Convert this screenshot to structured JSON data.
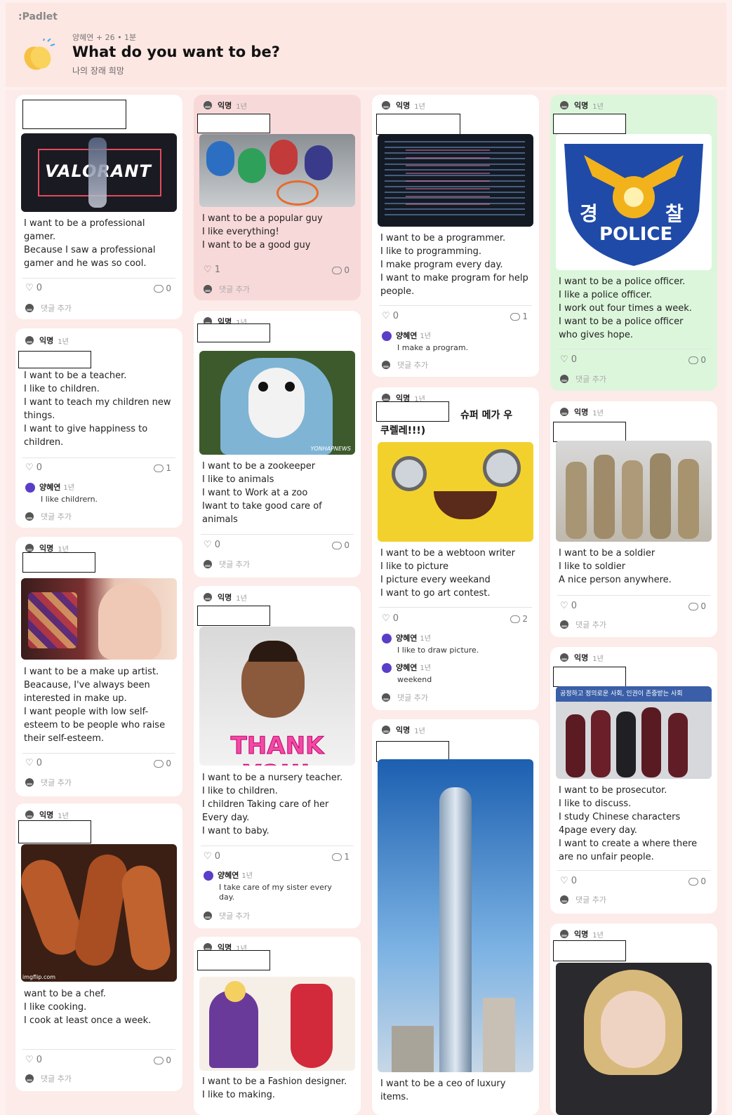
{
  "app": {
    "logo": ":Padlet"
  },
  "header": {
    "meta": "양혜연 + 26 • 1분",
    "title": "What do you want to be?",
    "subtitle": "나의 장래 희망"
  },
  "common": {
    "anon": "익명",
    "time": "1년",
    "add_comment": "댓글 추가",
    "commenter": "양혜연"
  },
  "posts": {
    "valorant": {
      "body": "I want to be a professional\ngamer.\nBecause I saw a professional\ngamer and he was so cool.",
      "likes": "0",
      "comments": "0"
    },
    "teacher": {
      "body": "I want to be a teacher.\nI like to children.\nI want to teach my children new\nthings.\nI want to give happiness to\nchildren.",
      "likes": "0",
      "comments": "1",
      "reply": "I like childrern."
    },
    "makeup": {
      "body": "I want to be a make up artist.\nBeacause, I've always been\ninterested in make up.\nI want people with low self-\nesteem to be people who raise\ntheir self-esteem.",
      "likes": "0",
      "comments": "0"
    },
    "chef": {
      "body": "want to be a chef.\nI like cooking.\nI cook at least once a week.",
      "likes": "0",
      "comments": "0"
    },
    "popular": {
      "body": "I want to be a popular guy\nI like everything!\nI want to be a good guy",
      "likes": "1",
      "comments": "0"
    },
    "zookeeper": {
      "body": "I want to be a zookeeper\nI like to animals\nI want to Work at a zoo\nIwant to take good care of\nanimals",
      "likes": "0",
      "comments": "0"
    },
    "nursery": {
      "body": "I want to be a  nursery teacher.\nI like to children.\nI children Taking care of her\nEvery day.\nI want to baby.",
      "likes": "0",
      "comments": "1",
      "reply": "I take care of my sister every\nday."
    },
    "fashion": {
      "body": "I want to be a Fashion designer.\nI like to making."
    },
    "programmer": {
      "body": "I want to be a programmer.\nI like to programming.\nI make program every day.\nI want to make program for help\npeople.",
      "likes": "0",
      "comments": "1",
      "reply": "I make a program."
    },
    "webtoon": {
      "title_a": "슈퍼 메가 우",
      "title_b": "쿠렐레!!!)",
      "body": "I want to be a webtoon writer\nI like to picture\nI picture every weekand\nI want to go art contest.",
      "likes": "0",
      "comments": "2",
      "reply1": "I like to draw picture.",
      "reply2": "weekend"
    },
    "ceo": {
      "body": "I want to be a ceo of luxury\nitems."
    },
    "police": {
      "badge_left": "경",
      "badge_right": "찰",
      "badge_text": "POLICE",
      "body": "I want to be a police officer.\nI like a police officer.\nI work out four times a week.\nI want to be a police officer\nwho gives hope.",
      "likes": "0",
      "comments": "0"
    },
    "soldier": {
      "body": "I want to be a soldier\nI like to soldier\nA nice person anywhere.",
      "likes": "0",
      "comments": "0"
    },
    "prosecutor": {
      "banner": "공정하고 정의로운 사회, 인권이 존중받는 사회",
      "body": "I want to be prosecutor.\nI like to discuss.\nI study Chinese characters\n4page every day.\nI want to create a where there\nare no unfair people.",
      "likes": "0",
      "comments": "0"
    },
    "writer": {}
  },
  "images": {
    "valorant_text": "VALORANT",
    "thank_you": "THANK YOU!",
    "yonhap": "YONHAPNEWS",
    "imgflip": "imgflip.com"
  },
  "colors": {
    "accent": "#5a3ec8",
    "pink_card": "#f8d9d9",
    "green_card": "#dcf6dc",
    "bg": "#fdf0ee"
  }
}
